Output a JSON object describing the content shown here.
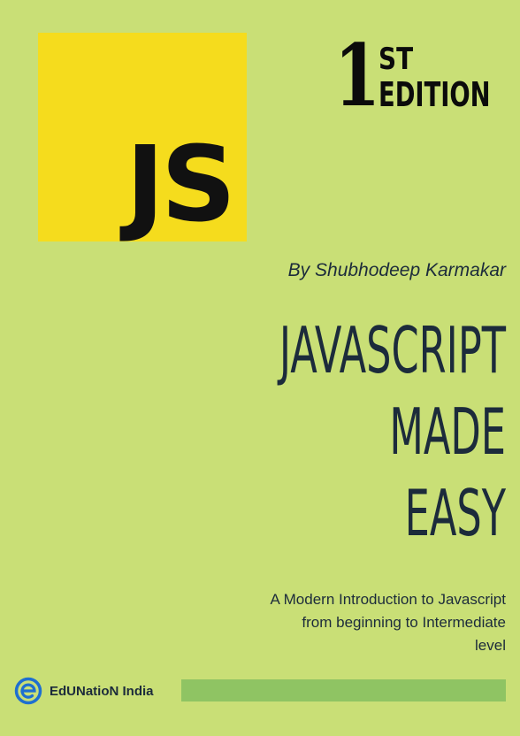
{
  "cover": {
    "logo_text": "JS",
    "edition_number": "1",
    "edition_suffix": "ST",
    "edition_word": "EDITION",
    "author": "By Shubhodeep Karmakar",
    "title_lines": [
      "JAVASCRIPT",
      "MADE",
      "EASY"
    ],
    "subtitle_lines": [
      "A Modern Introduction to Javascript",
      "from beginning to Intermediate",
      "level"
    ],
    "publisher_name": "EdUNatioN India",
    "publisher_icon": "e-logo-icon"
  },
  "colors": {
    "background": "#c9df76",
    "logo_yellow": "#f5dc1d",
    "text_dark": "#1c2b3b",
    "bar_green": "#8fc463",
    "publisher_blue": "#1e6fd0"
  }
}
